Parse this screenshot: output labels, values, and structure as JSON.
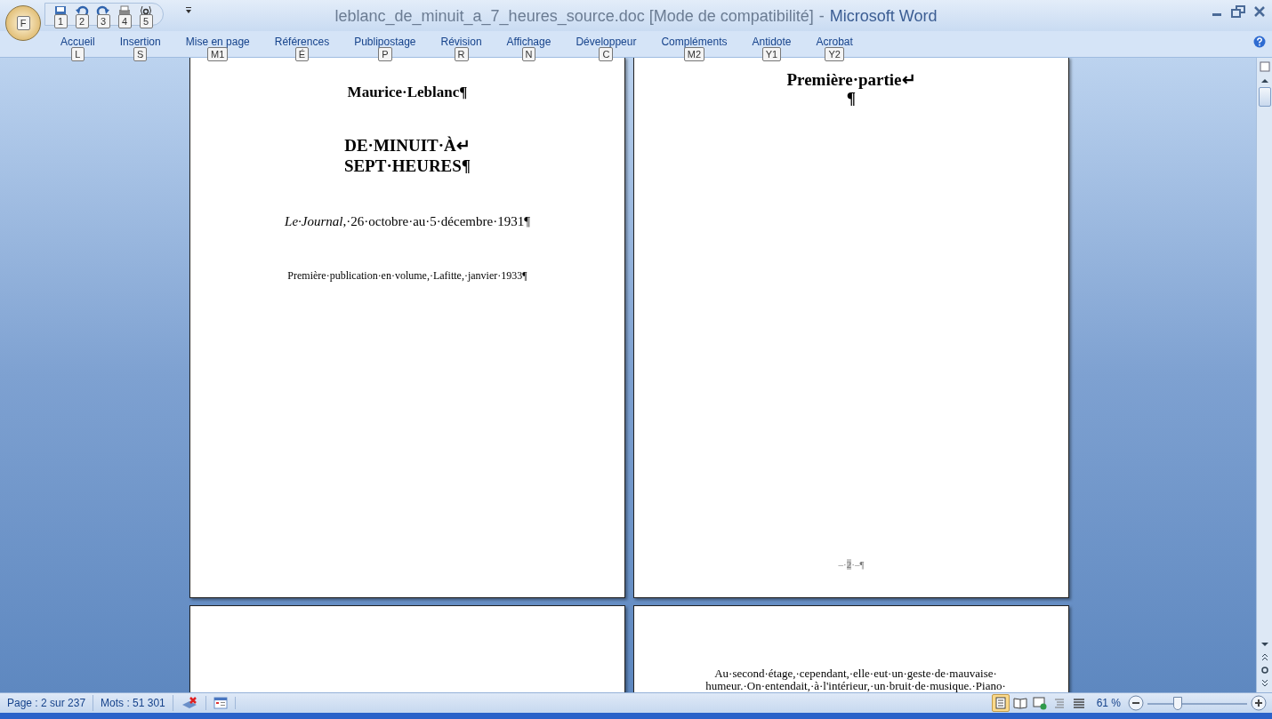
{
  "window": {
    "title": "leblanc_de_minuit_a_7_heures_source.doc [Mode de compatibilité]",
    "separator": "-",
    "app_name": "Microsoft Word",
    "office_button_keytip": "F"
  },
  "quick_access": [
    {
      "kind": "save",
      "keytip": "1"
    },
    {
      "kind": "undo",
      "keytip": "2"
    },
    {
      "kind": "redo",
      "keytip": "3"
    },
    {
      "kind": "print",
      "keytip": "4"
    },
    {
      "kind": "spell",
      "keytip": "5"
    }
  ],
  "ribbon_tabs": [
    {
      "label": "Accueil",
      "keytip": "L"
    },
    {
      "label": "Insertion",
      "keytip": "S"
    },
    {
      "label": "Mise en page",
      "keytip": "M1"
    },
    {
      "label": "Références",
      "keytip": "É"
    },
    {
      "label": "Publipostage",
      "keytip": "P"
    },
    {
      "label": "Révision",
      "keytip": "R"
    },
    {
      "label": "Affichage",
      "keytip": "N"
    },
    {
      "label": "Développeur",
      "keytip": "C"
    },
    {
      "label": "Compléments",
      "keytip": "M2"
    },
    {
      "label": "Antidote",
      "keytip": "Y1"
    },
    {
      "label": "Acrobat",
      "keytip": "Y2"
    }
  ],
  "pages": [
    {
      "kind": "text",
      "paragraphs": [
        {
          "kind": "author",
          "text": "Maurice·Leblanc¶"
        },
        {
          "kind": "title",
          "lines": [
            "DE·MINUIT·À↵",
            "SEPT·HEURES¶"
          ]
        },
        {
          "kind": "source",
          "text": "*Le·Journal*,·26·octobre·au·5·décembre·1931¶"
        },
        {
          "kind": "note",
          "text": "Première·publication·en·volume,·Lafitte,·janvier·1933¶"
        }
      ]
    },
    {
      "kind": "text",
      "paragraphs": [
        {
          "kind": "part",
          "lines": [
            "Première·partie↵",
            "¶"
          ]
        }
      ],
      "footer": {
        "before": "–·",
        "number": "2",
        "after": "·–¶"
      }
    },
    {
      "kind": "blank"
    },
    {
      "kind": "text",
      "paragraphs": [
        {
          "kind": "body",
          "lines": [
            "Au·second·étage,·cependant,·elle·eut·un·geste·de·mauvaise·",
            "humeur.·On·entendait,·à·l'intérieur,·un·bruit·de·musique.·Piano·"
          ]
        }
      ]
    }
  ],
  "status_bar": {
    "page": "Page : 2 sur 237",
    "words": "Mots : 51 301",
    "views": [
      {
        "kind": "print",
        "selected": true
      },
      {
        "kind": "reading",
        "selected": false
      },
      {
        "kind": "web",
        "selected": false
      },
      {
        "kind": "outline",
        "selected": false
      },
      {
        "kind": "draft",
        "selected": false
      }
    ],
    "zoom": "61 %",
    "zoom_slider": {
      "level": 0.3
    }
  }
}
